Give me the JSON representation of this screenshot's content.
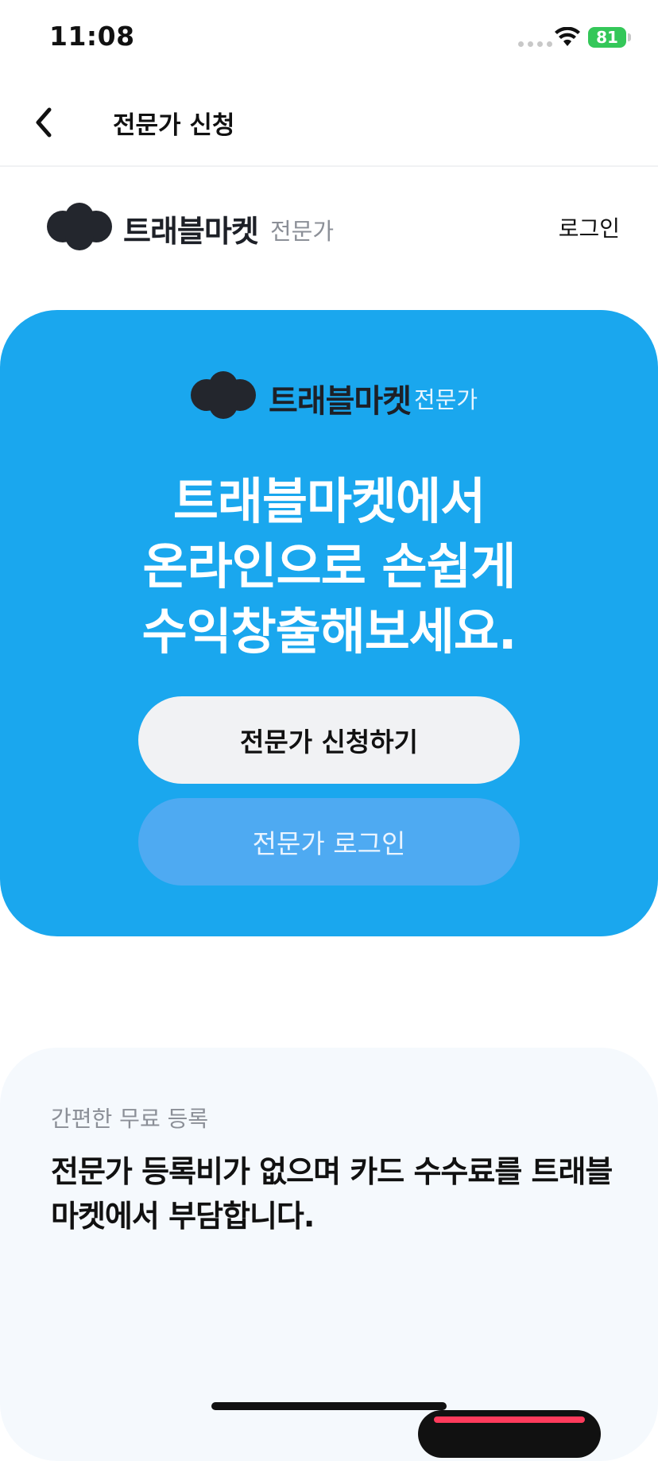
{
  "status_bar": {
    "time": "11:08",
    "battery": "81"
  },
  "header": {
    "title": "전문가 신청"
  },
  "brand": {
    "name": "트래블마켓",
    "sub": "전문가",
    "login_link": "로그인"
  },
  "hero": {
    "brand_name": "트래블마켓",
    "brand_sub": "전문가",
    "headline": [
      "트래블마켓에서",
      "온라인으로 손쉽게",
      "수익창출해보세요."
    ],
    "apply_button": "전문가 신청하기",
    "login_button": "전문가 로그인"
  },
  "info": {
    "tag": "간편한 무료 등록",
    "text": "전문가 등록비가 없으며 카드 수수료를 트래블마켓에서 부담합니다."
  },
  "colors": {
    "accent": "#1aa7ee",
    "secondary_button": "#4eaaf2",
    "battery": "#34c759",
    "info_background": "#f5f9fd"
  },
  "icons": {
    "back": "chevron-left-icon",
    "wifi": "wifi-icon",
    "battery": "battery-charging-icon",
    "logo": "cloud-logo-icon"
  }
}
